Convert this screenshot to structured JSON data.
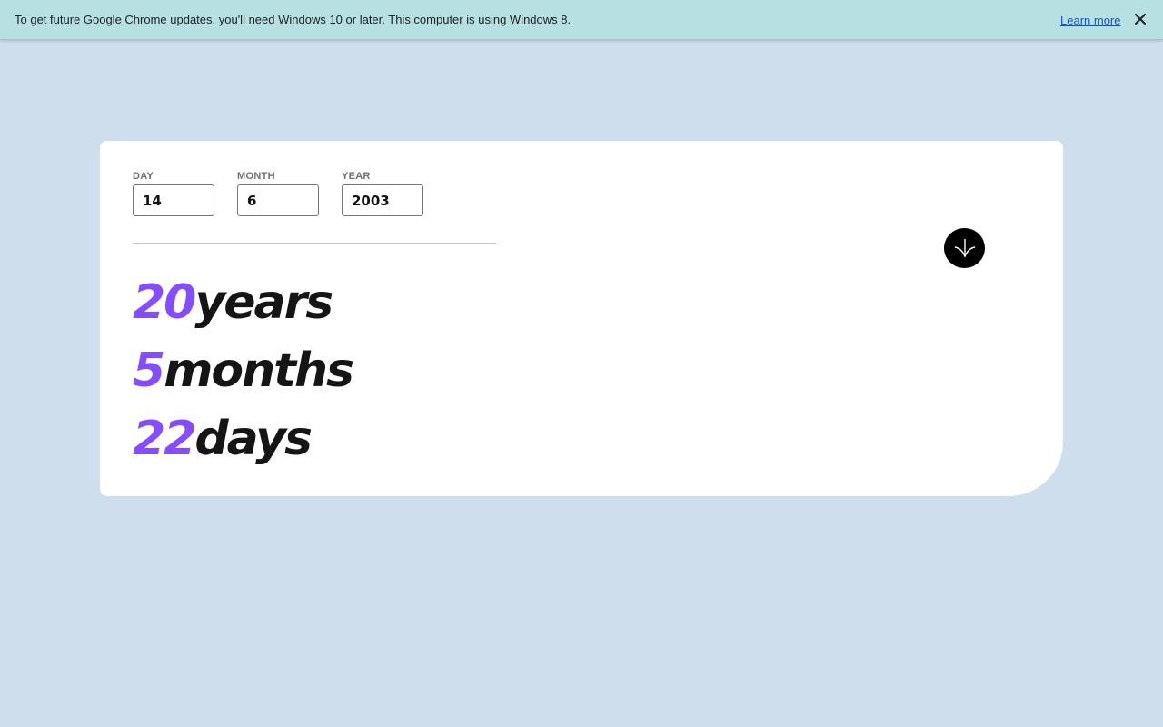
{
  "infobar": {
    "message": "To get future Google Chrome updates, you'll need Windows 10 or later. This computer is using Windows 8.",
    "learn_more": "Learn more",
    "close_icon": "close-icon"
  },
  "form": {
    "day": {
      "label": "DAY",
      "value": "14"
    },
    "month": {
      "label": "MONTH",
      "value": "6"
    },
    "year": {
      "label": "YEAR",
      "value": "2003"
    },
    "submit_icon": "arrow-down-icon"
  },
  "results": {
    "years": {
      "value": "20",
      "unit": "years"
    },
    "months": {
      "value": "5",
      "unit": "months"
    },
    "days": {
      "value": "22",
      "unit": "days"
    }
  },
  "colors": {
    "accent": "#854dff",
    "background": "#cfdeed",
    "infobar": "#b6e0e2",
    "text": "#151515"
  }
}
